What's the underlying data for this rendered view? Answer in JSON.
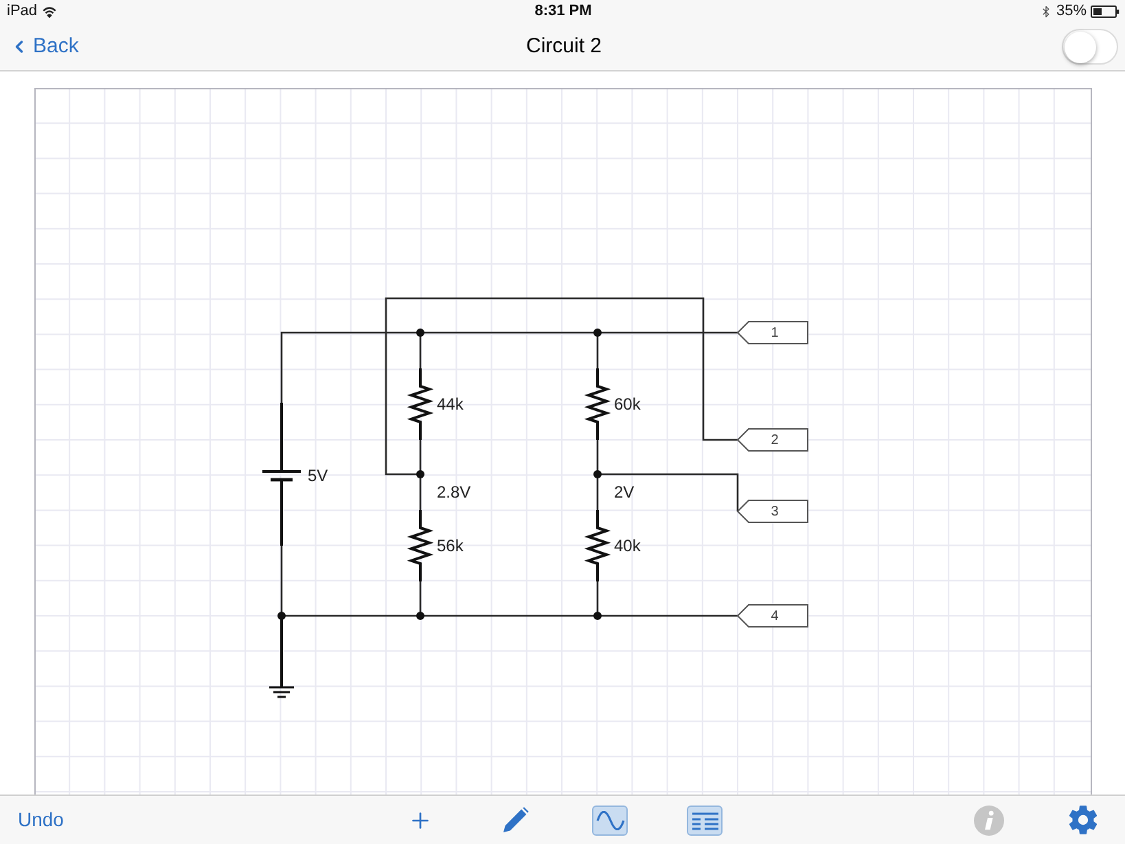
{
  "status_bar": {
    "carrier": "iPad",
    "time": "8:31 PM",
    "battery": "35%"
  },
  "nav_bar": {
    "back": "Back",
    "title": "Circuit 2",
    "switch": {
      "on": false
    }
  },
  "schematic": {
    "source": {
      "label": "5V"
    },
    "resistors": [
      {
        "label": "44k"
      },
      {
        "label": "60k"
      },
      {
        "label": "56k"
      },
      {
        "label": "40k"
      }
    ],
    "node_voltages": [
      "2.8V",
      "2V"
    ],
    "terminals": [
      "1",
      "2",
      "3",
      "4"
    ]
  },
  "toolbar": {
    "undo": "Undo",
    "tools": [
      {
        "kind": "add",
        "on": false
      },
      {
        "kind": "pencil",
        "on": false
      },
      {
        "kind": "waveform",
        "on": true
      },
      {
        "kind": "list",
        "on": true
      }
    ],
    "actions": [
      {
        "kind": "info",
        "disabled": true
      },
      {
        "kind": "settings",
        "disabled": false
      }
    ]
  }
}
